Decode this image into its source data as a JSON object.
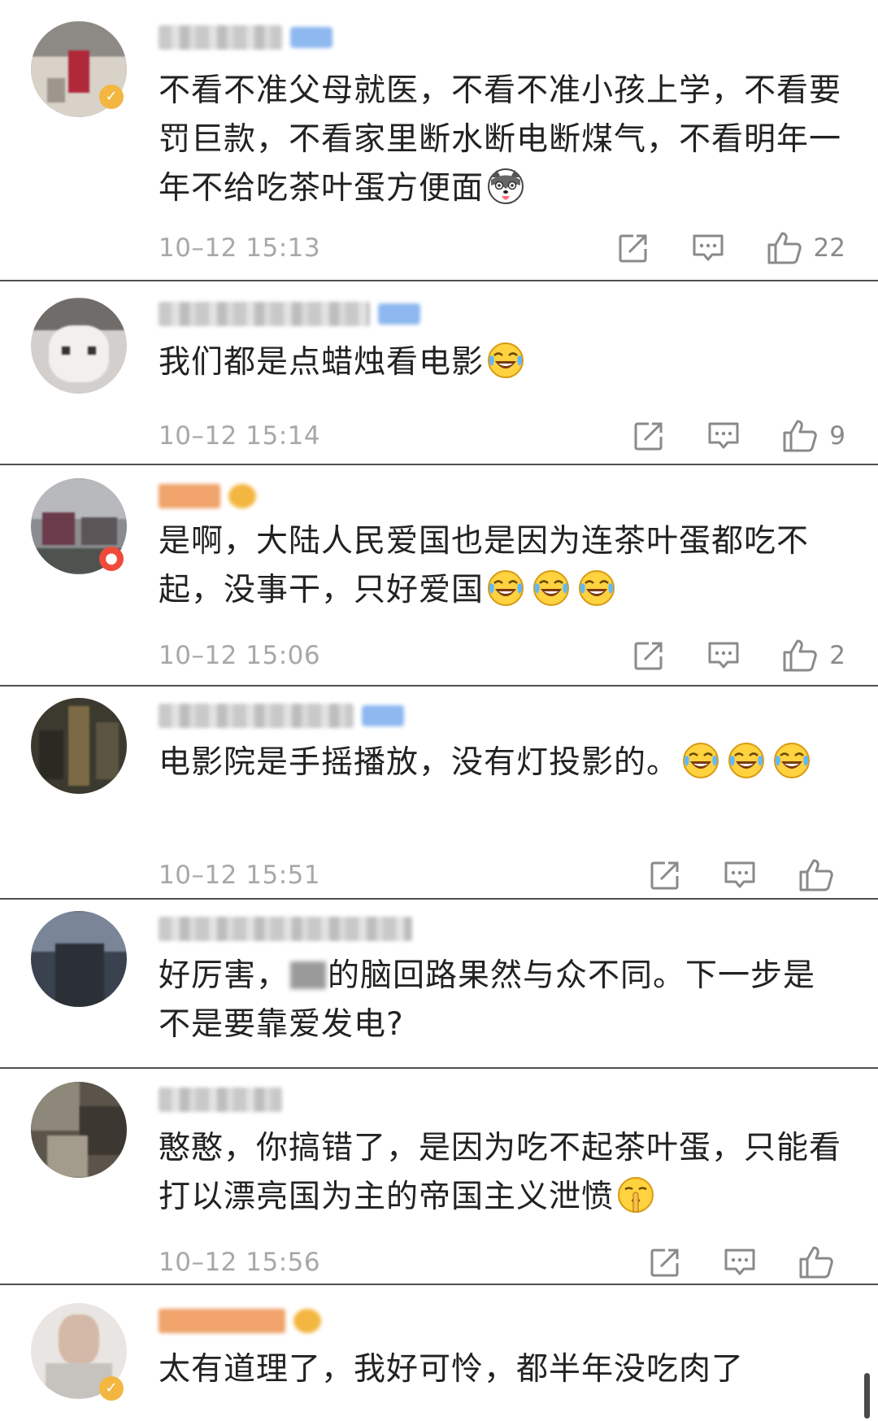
{
  "comments": [
    {
      "text": "不看不准父母就医，不看不准小孩上学，不看要罚巨款，不看家里断水断电断煤气，不看明年一年不给吃茶叶蛋方便面",
      "emoji": "husky-dog-emoji",
      "time": "10–12 15:13",
      "likes": "22"
    },
    {
      "text": "我们都是点蜡烛看电影",
      "emoji": "laugh-cry-emoji",
      "time": "10–12 15:14",
      "likes": "9"
    },
    {
      "text": "是啊，大陆人民爱国也是因为连茶叶蛋都吃不起，没事干，只好爱国",
      "emoji": "laugh-cry-emoji",
      "time": "10–12 15:06",
      "likes": "2"
    },
    {
      "text": "电影院是手摇播放，没有灯投影的。",
      "emoji": "laugh-cry-emoji",
      "time": "10–12 15:51",
      "likes": ""
    },
    {
      "text_a": "好厉害，",
      "text_b": "的脑回路果然与众不同。下一步是不是要靠爱发电?",
      "time": "",
      "likes": ""
    },
    {
      "text": "憨憨，你搞错了，是因为吃不起茶叶蛋，只能看打以漂亮国为主的帝国主义泄愤",
      "emoji": "shush-emoji",
      "time": "10–12 15:56",
      "likes": ""
    },
    {
      "text": "太有道理了，我好可怜，都半年没吃肉了"
    }
  ],
  "colors": {
    "text": "#222222",
    "meta": "#a8a8a8",
    "icon": "#8a8a8a",
    "divider": "#505050",
    "member_badge": "#8db8f0",
    "gold_badge": "#f3b640"
  }
}
